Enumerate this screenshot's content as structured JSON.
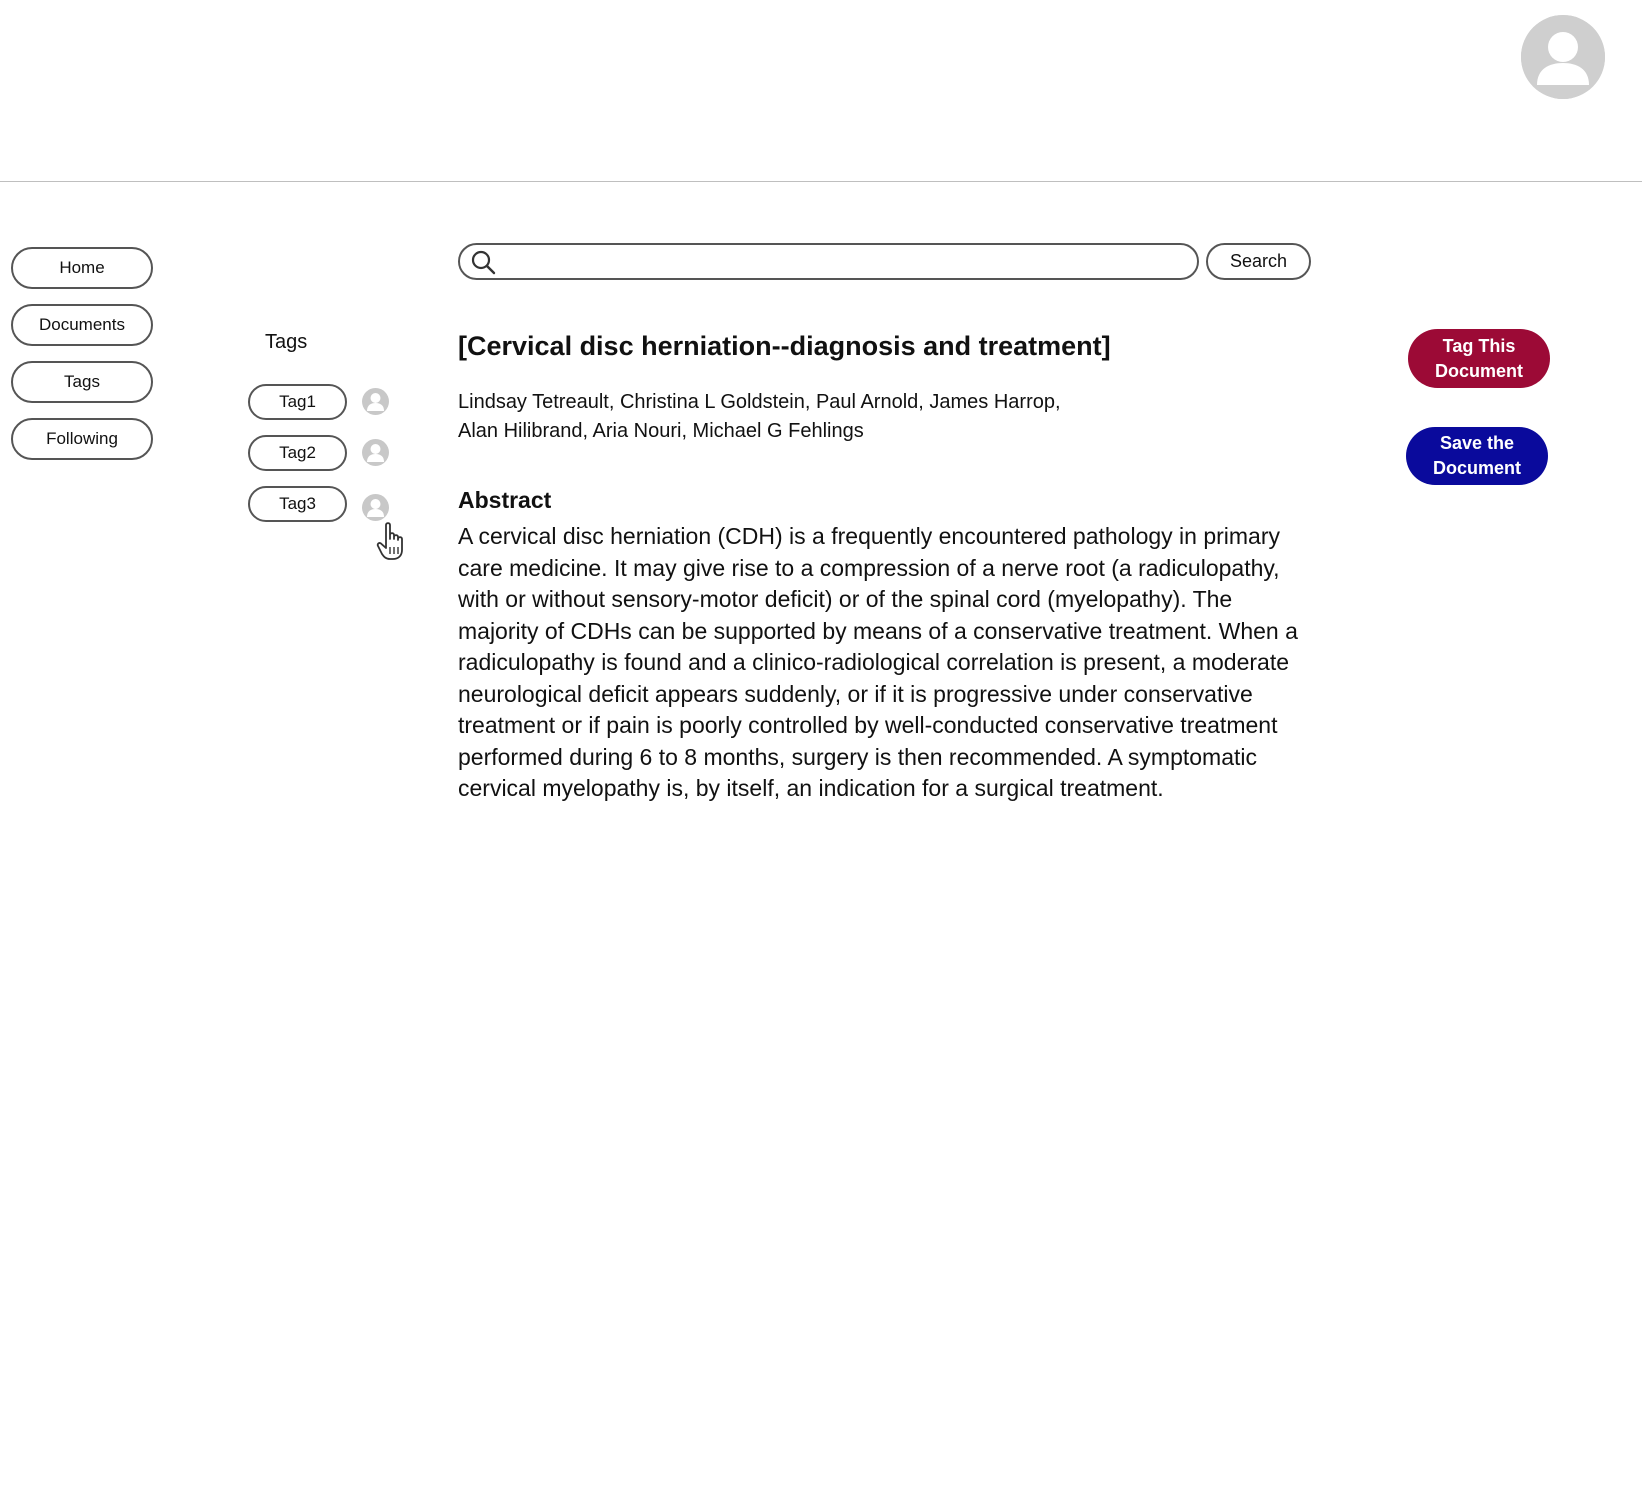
{
  "header": {
    "avatar_icon": "user-avatar-icon"
  },
  "sidebar": {
    "items": [
      {
        "label": "Home"
      },
      {
        "label": "Documents"
      },
      {
        "label": "Tags"
      },
      {
        "label": "Following"
      }
    ]
  },
  "tags_panel": {
    "heading": "Tags",
    "tags": [
      {
        "label": "Tag1",
        "icon": "user-icon"
      },
      {
        "label": "Tag2",
        "icon": "user-icon"
      },
      {
        "label": "Tag3",
        "icon": "user-icon"
      }
    ],
    "cursor_icon": "hand-pointer-icon"
  },
  "search": {
    "value": "",
    "button_label": "Search",
    "icon": "search-icon"
  },
  "document": {
    "title": "[Cervical disc herniation--diagnosis and treatment]",
    "authors_line1": "Lindsay Tetreault, Christina L Goldstein, Paul Arnold, James Harrop,",
    "authors_line2": "Alan Hilibrand, Aria Nouri, Michael G Fehlings",
    "abstract_heading": "Abstract",
    "abstract_text": "A cervical disc herniation (CDH) is a frequently encountered pathology in primary care medicine. It may give rise to a compression of a nerve root (a radiculopathy, with or without sensory-motor deficit) or of the spinal cord (myelopathy). The majority of CDHs can be supported by means of a conservative treatment. When a radiculopathy is found and a clinico-radiological correlation is present, a moderate neurological deficit appears suddenly, or if it is progressive under conservative treatment or if pain is poorly controlled by well-conducted conservative treatment performed during 6 to 8 months, surgery is then recommended. A symptomatic cervical myelopathy is, by itself, an indication for a surgical treatment."
  },
  "actions": {
    "tag_document": {
      "line1": "Tag This",
      "line2": "Document",
      "color": "#9c0a36"
    },
    "save_document": {
      "line1": "Save the",
      "line2": "Document",
      "color": "#0a0a9c"
    }
  }
}
